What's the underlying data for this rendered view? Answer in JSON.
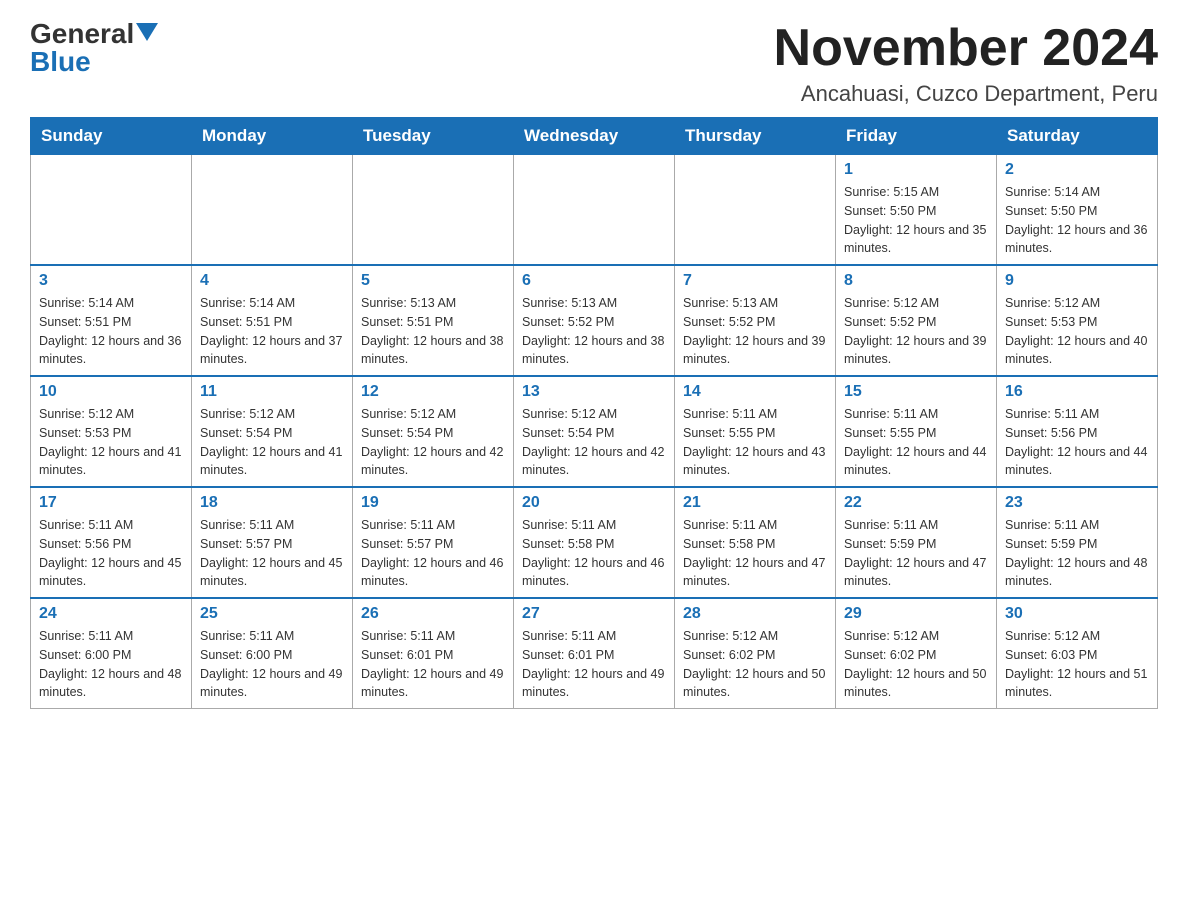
{
  "logo": {
    "general": "General",
    "blue": "Blue"
  },
  "title": "November 2024",
  "location": "Ancahuasi, Cuzco Department, Peru",
  "days_of_week": [
    "Sunday",
    "Monday",
    "Tuesday",
    "Wednesday",
    "Thursday",
    "Friday",
    "Saturday"
  ],
  "weeks": [
    [
      {
        "day": "",
        "sunrise": "",
        "sunset": "",
        "daylight": ""
      },
      {
        "day": "",
        "sunrise": "",
        "sunset": "",
        "daylight": ""
      },
      {
        "day": "",
        "sunrise": "",
        "sunset": "",
        "daylight": ""
      },
      {
        "day": "",
        "sunrise": "",
        "sunset": "",
        "daylight": ""
      },
      {
        "day": "",
        "sunrise": "",
        "sunset": "",
        "daylight": ""
      },
      {
        "day": "1",
        "sunrise": "Sunrise: 5:15 AM",
        "sunset": "Sunset: 5:50 PM",
        "daylight": "Daylight: 12 hours and 35 minutes."
      },
      {
        "day": "2",
        "sunrise": "Sunrise: 5:14 AM",
        "sunset": "Sunset: 5:50 PM",
        "daylight": "Daylight: 12 hours and 36 minutes."
      }
    ],
    [
      {
        "day": "3",
        "sunrise": "Sunrise: 5:14 AM",
        "sunset": "Sunset: 5:51 PM",
        "daylight": "Daylight: 12 hours and 36 minutes."
      },
      {
        "day": "4",
        "sunrise": "Sunrise: 5:14 AM",
        "sunset": "Sunset: 5:51 PM",
        "daylight": "Daylight: 12 hours and 37 minutes."
      },
      {
        "day": "5",
        "sunrise": "Sunrise: 5:13 AM",
        "sunset": "Sunset: 5:51 PM",
        "daylight": "Daylight: 12 hours and 38 minutes."
      },
      {
        "day": "6",
        "sunrise": "Sunrise: 5:13 AM",
        "sunset": "Sunset: 5:52 PM",
        "daylight": "Daylight: 12 hours and 38 minutes."
      },
      {
        "day": "7",
        "sunrise": "Sunrise: 5:13 AM",
        "sunset": "Sunset: 5:52 PM",
        "daylight": "Daylight: 12 hours and 39 minutes."
      },
      {
        "day": "8",
        "sunrise": "Sunrise: 5:12 AM",
        "sunset": "Sunset: 5:52 PM",
        "daylight": "Daylight: 12 hours and 39 minutes."
      },
      {
        "day": "9",
        "sunrise": "Sunrise: 5:12 AM",
        "sunset": "Sunset: 5:53 PM",
        "daylight": "Daylight: 12 hours and 40 minutes."
      }
    ],
    [
      {
        "day": "10",
        "sunrise": "Sunrise: 5:12 AM",
        "sunset": "Sunset: 5:53 PM",
        "daylight": "Daylight: 12 hours and 41 minutes."
      },
      {
        "day": "11",
        "sunrise": "Sunrise: 5:12 AM",
        "sunset": "Sunset: 5:54 PM",
        "daylight": "Daylight: 12 hours and 41 minutes."
      },
      {
        "day": "12",
        "sunrise": "Sunrise: 5:12 AM",
        "sunset": "Sunset: 5:54 PM",
        "daylight": "Daylight: 12 hours and 42 minutes."
      },
      {
        "day": "13",
        "sunrise": "Sunrise: 5:12 AM",
        "sunset": "Sunset: 5:54 PM",
        "daylight": "Daylight: 12 hours and 42 minutes."
      },
      {
        "day": "14",
        "sunrise": "Sunrise: 5:11 AM",
        "sunset": "Sunset: 5:55 PM",
        "daylight": "Daylight: 12 hours and 43 minutes."
      },
      {
        "day": "15",
        "sunrise": "Sunrise: 5:11 AM",
        "sunset": "Sunset: 5:55 PM",
        "daylight": "Daylight: 12 hours and 44 minutes."
      },
      {
        "day": "16",
        "sunrise": "Sunrise: 5:11 AM",
        "sunset": "Sunset: 5:56 PM",
        "daylight": "Daylight: 12 hours and 44 minutes."
      }
    ],
    [
      {
        "day": "17",
        "sunrise": "Sunrise: 5:11 AM",
        "sunset": "Sunset: 5:56 PM",
        "daylight": "Daylight: 12 hours and 45 minutes."
      },
      {
        "day": "18",
        "sunrise": "Sunrise: 5:11 AM",
        "sunset": "Sunset: 5:57 PM",
        "daylight": "Daylight: 12 hours and 45 minutes."
      },
      {
        "day": "19",
        "sunrise": "Sunrise: 5:11 AM",
        "sunset": "Sunset: 5:57 PM",
        "daylight": "Daylight: 12 hours and 46 minutes."
      },
      {
        "day": "20",
        "sunrise": "Sunrise: 5:11 AM",
        "sunset": "Sunset: 5:58 PM",
        "daylight": "Daylight: 12 hours and 46 minutes."
      },
      {
        "day": "21",
        "sunrise": "Sunrise: 5:11 AM",
        "sunset": "Sunset: 5:58 PM",
        "daylight": "Daylight: 12 hours and 47 minutes."
      },
      {
        "day": "22",
        "sunrise": "Sunrise: 5:11 AM",
        "sunset": "Sunset: 5:59 PM",
        "daylight": "Daylight: 12 hours and 47 minutes."
      },
      {
        "day": "23",
        "sunrise": "Sunrise: 5:11 AM",
        "sunset": "Sunset: 5:59 PM",
        "daylight": "Daylight: 12 hours and 48 minutes."
      }
    ],
    [
      {
        "day": "24",
        "sunrise": "Sunrise: 5:11 AM",
        "sunset": "Sunset: 6:00 PM",
        "daylight": "Daylight: 12 hours and 48 minutes."
      },
      {
        "day": "25",
        "sunrise": "Sunrise: 5:11 AM",
        "sunset": "Sunset: 6:00 PM",
        "daylight": "Daylight: 12 hours and 49 minutes."
      },
      {
        "day": "26",
        "sunrise": "Sunrise: 5:11 AM",
        "sunset": "Sunset: 6:01 PM",
        "daylight": "Daylight: 12 hours and 49 minutes."
      },
      {
        "day": "27",
        "sunrise": "Sunrise: 5:11 AM",
        "sunset": "Sunset: 6:01 PM",
        "daylight": "Daylight: 12 hours and 49 minutes."
      },
      {
        "day": "28",
        "sunrise": "Sunrise: 5:12 AM",
        "sunset": "Sunset: 6:02 PM",
        "daylight": "Daylight: 12 hours and 50 minutes."
      },
      {
        "day": "29",
        "sunrise": "Sunrise: 5:12 AM",
        "sunset": "Sunset: 6:02 PM",
        "daylight": "Daylight: 12 hours and 50 minutes."
      },
      {
        "day": "30",
        "sunrise": "Sunrise: 5:12 AM",
        "sunset": "Sunset: 6:03 PM",
        "daylight": "Daylight: 12 hours and 51 minutes."
      }
    ]
  ]
}
